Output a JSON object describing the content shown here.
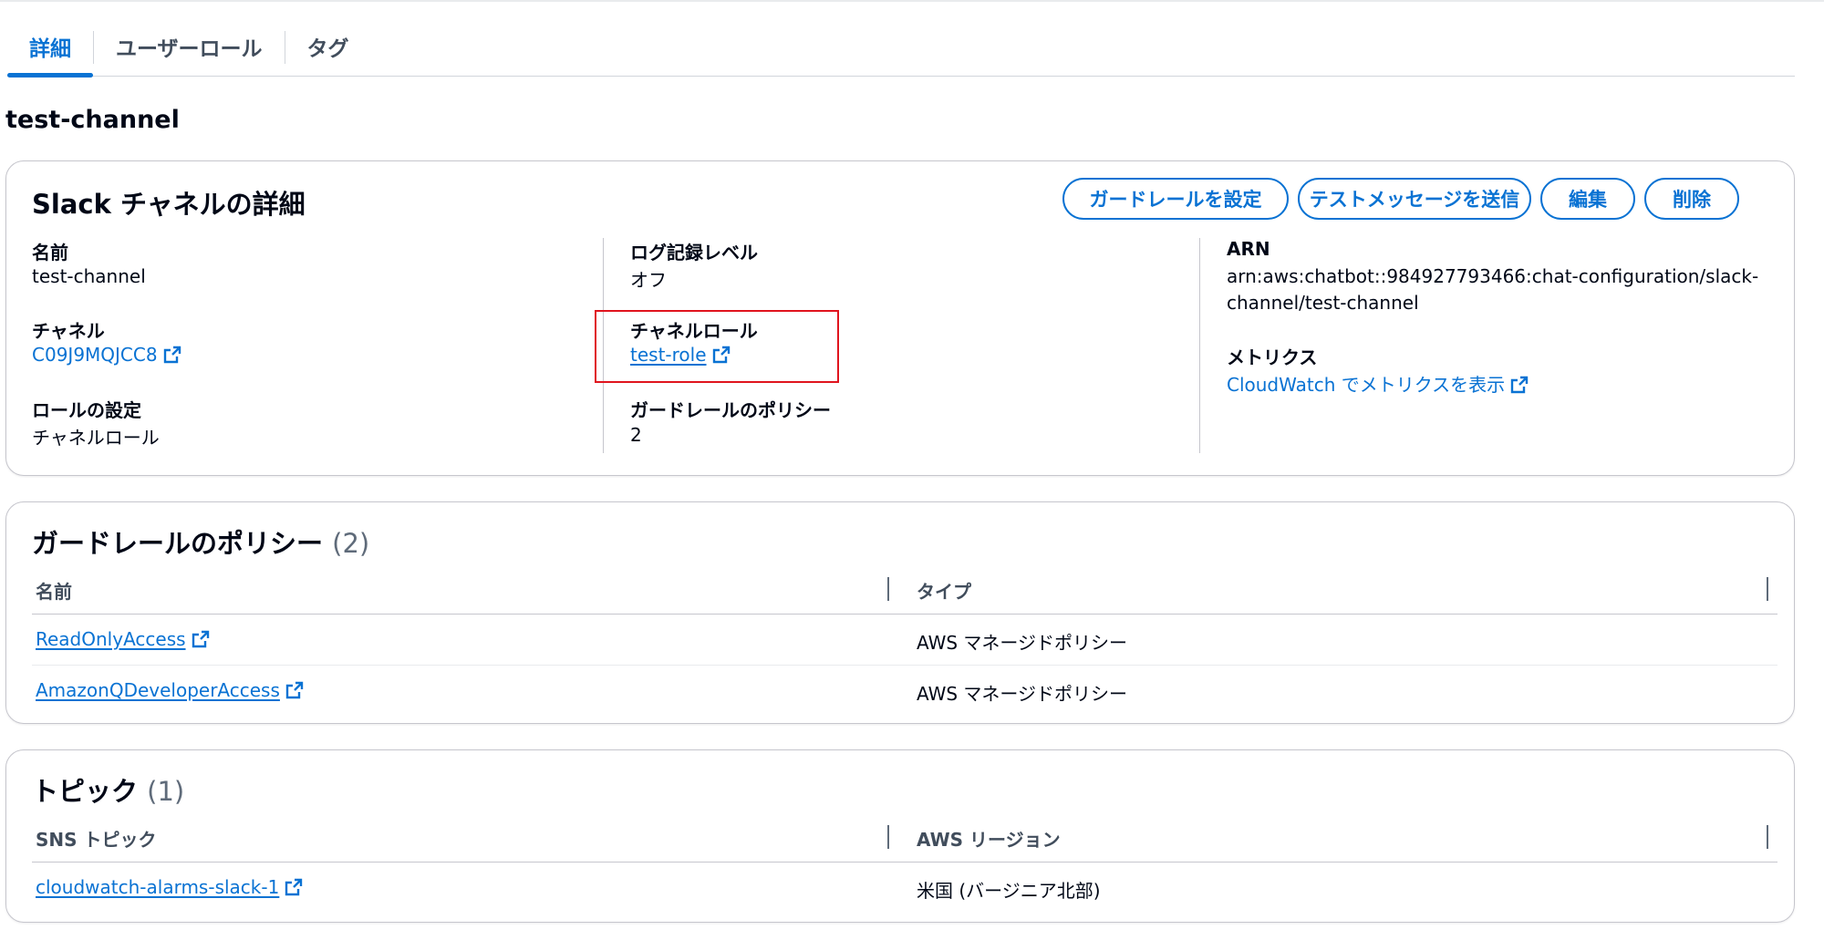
{
  "tabs": [
    {
      "label": "詳細",
      "active": true
    },
    {
      "label": "ユーザーロール",
      "active": false
    },
    {
      "label": "タグ",
      "active": false
    }
  ],
  "page_title": "test-channel",
  "details": {
    "title": "Slack チャネルの詳細",
    "buttons": {
      "guardrail": "ガードレールを設定",
      "test_message": "テストメッセージを送信",
      "edit": "編集",
      "delete": "削除"
    },
    "name": {
      "label": "名前",
      "value": "test-channel"
    },
    "channel": {
      "label": "チャネル",
      "value": "C09J9MQJCC8"
    },
    "role_setting": {
      "label": "ロールの設定",
      "value": "チャネルロール"
    },
    "logging": {
      "label": "ログ記録レベル",
      "value": "オフ"
    },
    "channel_role": {
      "label": "チャネルロール",
      "value": "test-role"
    },
    "guardrail_policy": {
      "label": "ガードレールのポリシー",
      "value": "2"
    },
    "arn": {
      "label": "ARN",
      "line1": "arn:aws:chatbot::984927793466:chat-configuration/slack-",
      "line2": "channel/test-channel"
    },
    "metrics": {
      "label": "メトリクス",
      "value": "CloudWatch でメトリクスを表示"
    }
  },
  "guardrails": {
    "title": "ガードレールのポリシー",
    "count": "(2)",
    "columns": [
      "名前",
      "タイプ"
    ],
    "rows": [
      {
        "name": "ReadOnlyAccess",
        "type": "AWS マネージドポリシー"
      },
      {
        "name": "AmazonQDeveloperAccess",
        "type": "AWS マネージドポリシー"
      }
    ]
  },
  "topics": {
    "title": "トピック",
    "count": "(1)",
    "columns": [
      "SNS トピック",
      "AWS リージョン"
    ],
    "rows": [
      {
        "topic": "cloudwatch-alarms-slack-1",
        "region": "米国 (バージニア北部)"
      }
    ]
  },
  "colors": {
    "accent": "#0972d3",
    "highlight": "#e0141e",
    "border": "#c6c6cd"
  },
  "icons": [
    "external-link-icon"
  ]
}
